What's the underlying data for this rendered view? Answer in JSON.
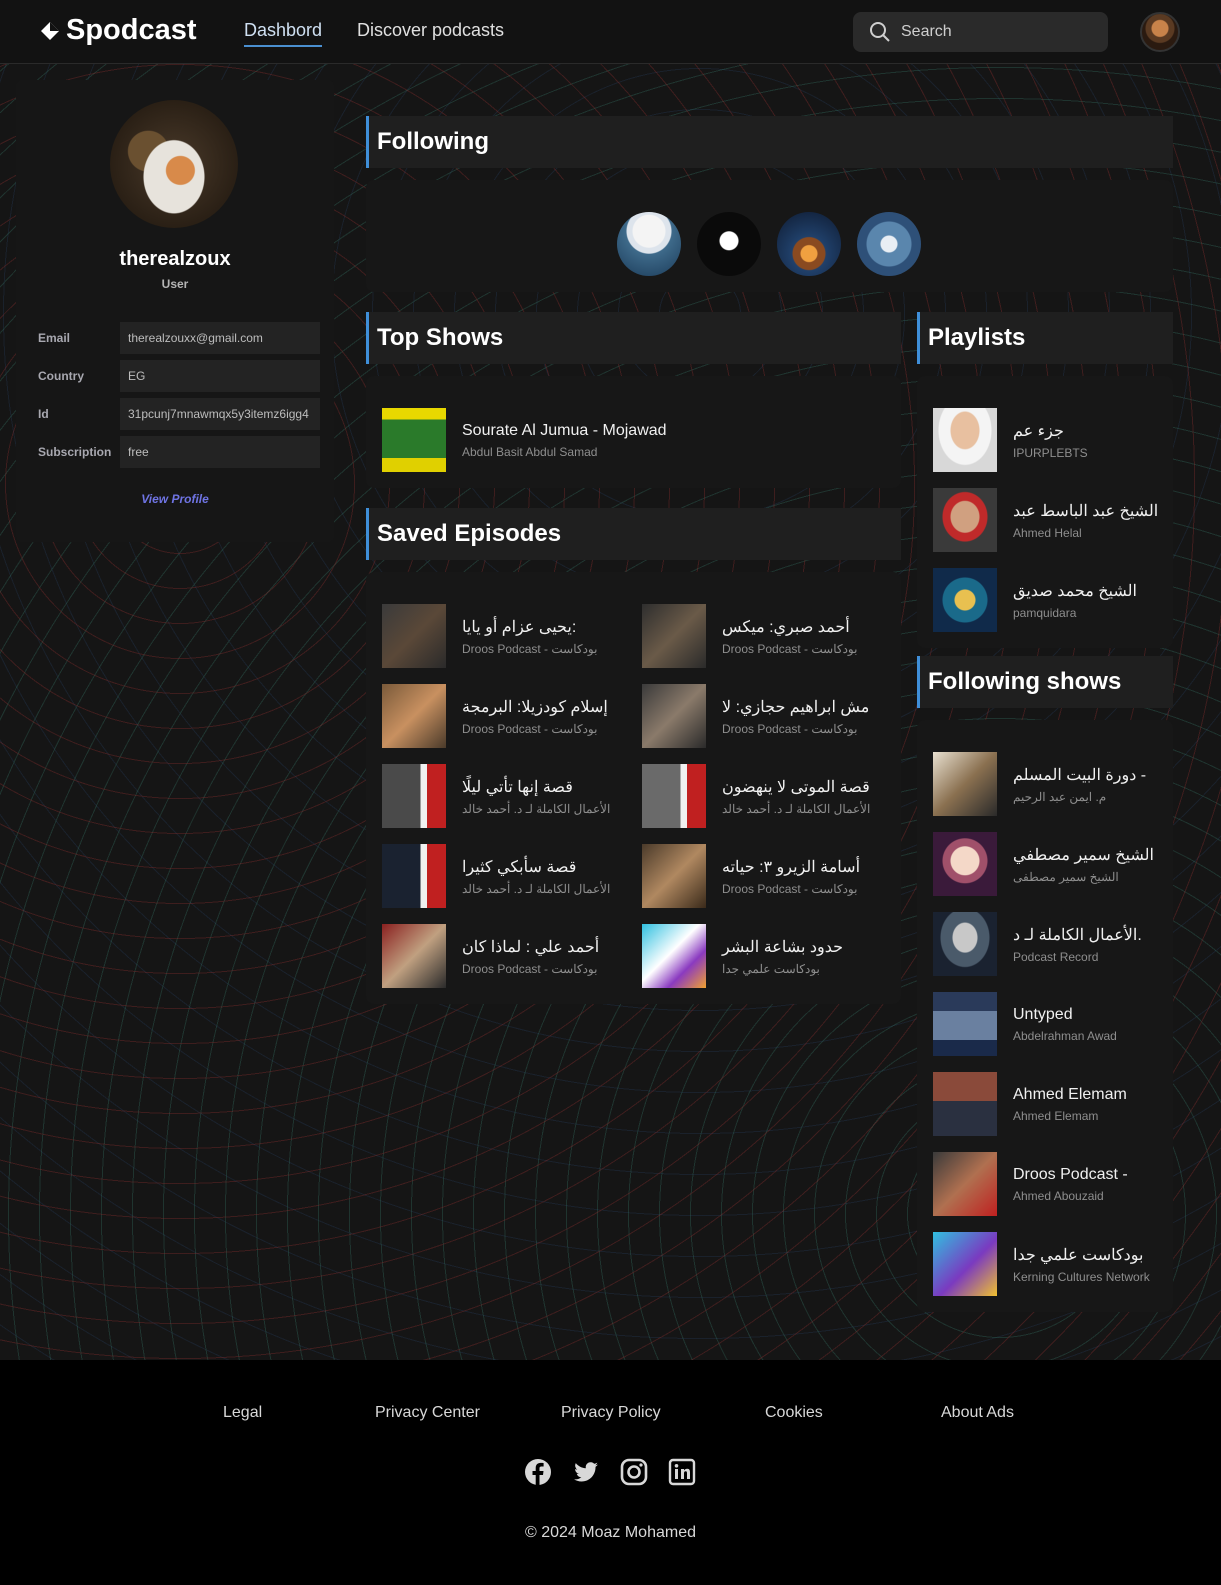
{
  "app": {
    "name": "Spodcast"
  },
  "nav": {
    "dashboard": "Dashbord",
    "discover": "Discover podcasts"
  },
  "search": {
    "placeholder": "Search"
  },
  "profile": {
    "username": "therealzoux",
    "role": "User",
    "fields": [
      {
        "label": "Email",
        "value": "therealzouxx@gmail.com"
      },
      {
        "label": "Country",
        "value": "EG"
      },
      {
        "label": "Id",
        "value": "31pcunj7mnawmqx5y3itemz6igg4"
      },
      {
        "label": "Subscription",
        "value": "free"
      }
    ],
    "view_profile": "View Profile"
  },
  "sections": {
    "following": "Following",
    "top_shows": "Top Shows",
    "saved_episodes": "Saved Episodes",
    "playlists": "Playlists",
    "following_shows": "Following shows"
  },
  "top_shows": [
    {
      "title": "Sourate Al Jumua - Mojawad",
      "subtitle": "Abdul Basit Abdul Samad"
    }
  ],
  "saved_episodes": [
    {
      "title": "يحيى عزام أو يايا:",
      "subtitle": "Droos Podcast - بودكاست"
    },
    {
      "title": "أحمد صبري: ميكس",
      "subtitle": "Droos Podcast - بودكاست"
    },
    {
      "title": "إسلام كودزيلا: البرمجة",
      "subtitle": "Droos Podcast - بودكاست"
    },
    {
      "title": "مش ابراهيم حجازي: لا",
      "subtitle": "Droos Podcast - بودكاست"
    },
    {
      "title": "قصة إنها تأتي ليلًا",
      "subtitle": "الأعمال الكاملة لـ د. أحمد خالد"
    },
    {
      "title": "قصة الموتى لا ينهضون",
      "subtitle": "الأعمال الكاملة لـ د. أحمد خالد"
    },
    {
      "title": "قصة سأبكي كثيرا",
      "subtitle": "الأعمال الكاملة لـ د. أحمد خالد"
    },
    {
      "title": "أسامة الزيرو ٣: حياته",
      "subtitle": "Droos Podcast - بودكاست"
    },
    {
      "title": "أحمد علي : لماذا كان",
      "subtitle": "Droos Podcast - بودكاست"
    },
    {
      "title": "حدود بشاعة البشر",
      "subtitle": "بودكاست علمي جدا"
    }
  ],
  "playlists": [
    {
      "title": "جزء عم",
      "subtitle": "IPURPLEBTS"
    },
    {
      "title": "الشيخ عبد الباسط عبد",
      "subtitle": "Ahmed Helal"
    },
    {
      "title": "الشيخ محمد صديق",
      "subtitle": "pamquidara"
    }
  ],
  "following_shows": [
    {
      "title": "دورة البيت المسلم -",
      "subtitle": "م. ايمن عبد الرحيم"
    },
    {
      "title": "الشيخ سمير مصطفي",
      "subtitle": "الشيخ سمير مصطفى"
    },
    {
      "title": "الأعمال الكاملة لـ د.",
      "subtitle": "Podcast Record"
    },
    {
      "title": "Untyped",
      "subtitle": "Abdelrahman Awad"
    },
    {
      "title": "Ahmed Elemam",
      "subtitle": "Ahmed Elemam"
    },
    {
      "title": "Droos Podcast -",
      "subtitle": "Ahmed Abouzaid"
    },
    {
      "title": "بودكاست علمي جدا",
      "subtitle": "Kerning Cultures Network"
    }
  ],
  "footer": {
    "links": [
      "Legal",
      "Privacy Center",
      "Privacy Policy",
      "Cookies",
      "About Ads"
    ],
    "social": [
      "facebook-icon",
      "twitter-icon",
      "instagram-icon",
      "linkedin-icon"
    ],
    "copyright": "© 2024 Moaz Mohamed"
  },
  "colors": {
    "accent": "#3f8fd9",
    "link": "#6f74e4",
    "background": "#151515"
  }
}
